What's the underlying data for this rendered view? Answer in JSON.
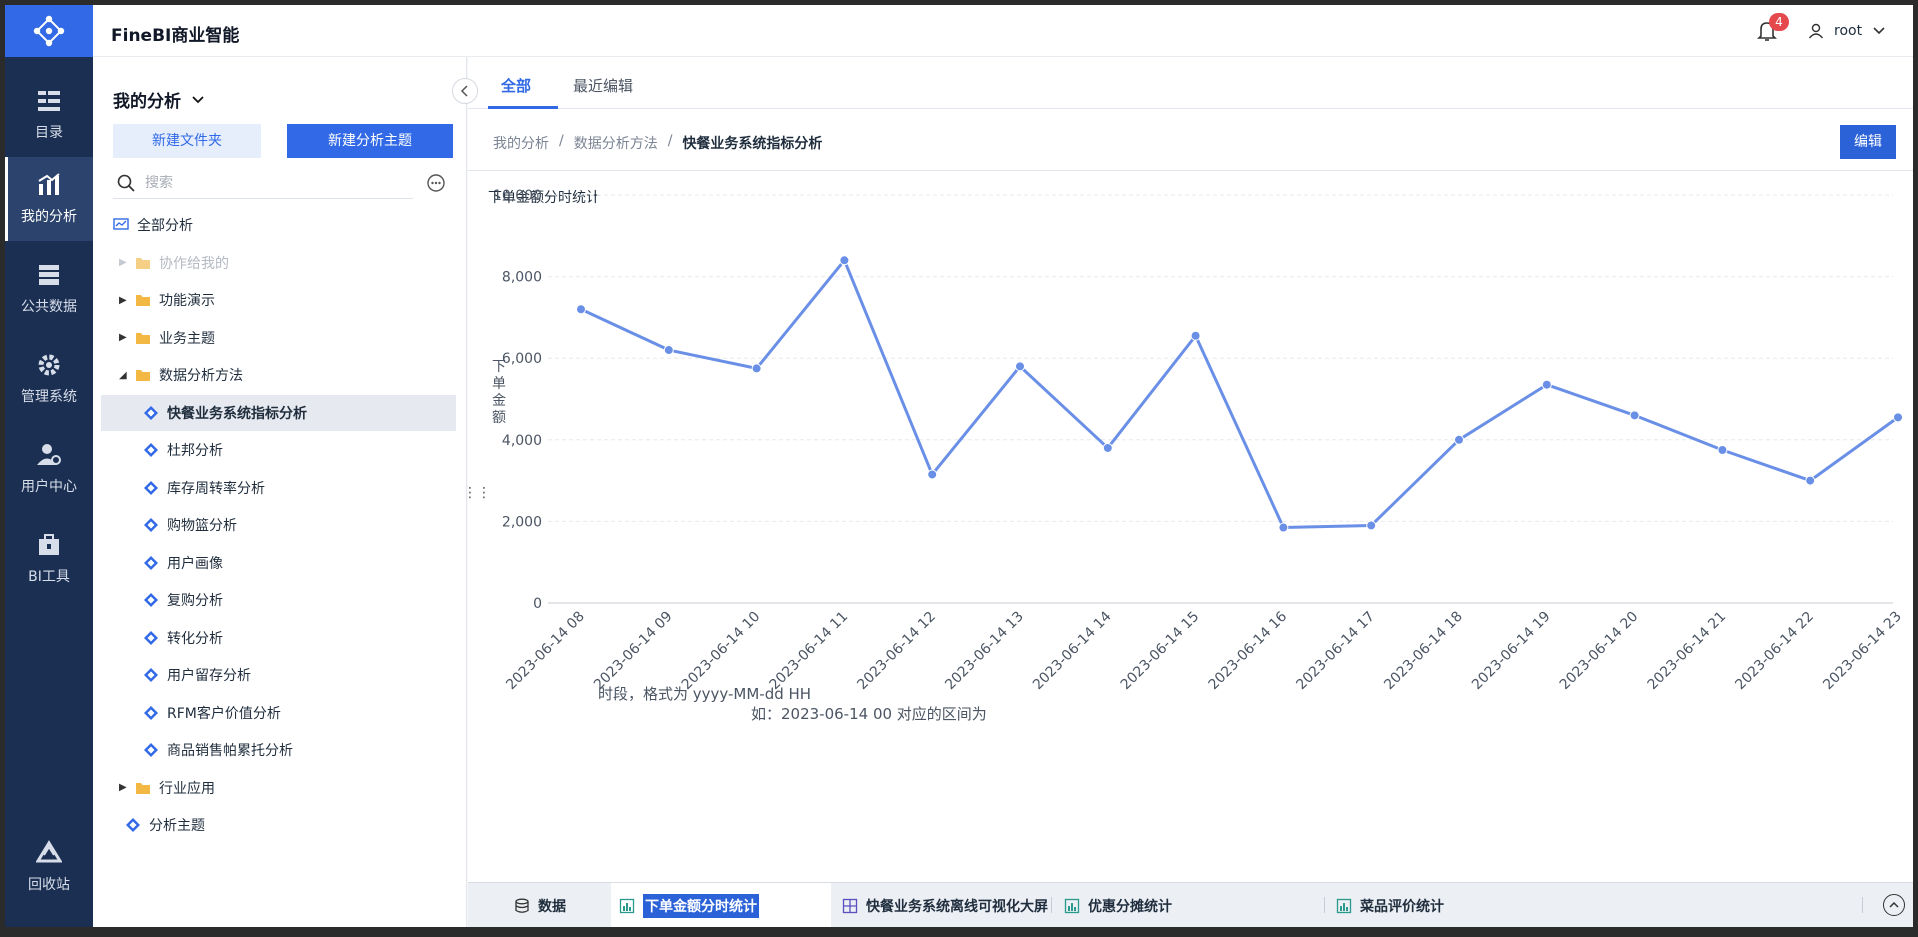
{
  "app": {
    "title": "FineBI商业智能"
  },
  "nav": [
    {
      "label": "目录",
      "icon": "catalog-icon"
    },
    {
      "label": "我的分析",
      "icon": "analysis-icon",
      "active": true
    },
    {
      "label": "公共数据",
      "icon": "database-icon"
    },
    {
      "label": "管理系统",
      "icon": "gear-icon"
    },
    {
      "label": "用户中心",
      "icon": "user-gear-icon"
    },
    {
      "label": "BI工具",
      "icon": "toolbox-icon"
    },
    {
      "label": "回收站",
      "icon": "recycle-icon"
    }
  ],
  "header": {
    "notifications": "4",
    "user": "root"
  },
  "sidebar": {
    "title": "我的分析",
    "new_folder": "新建文件夹",
    "new_topic": "新建分析主题",
    "search_placeholder": "搜索",
    "tree": [
      {
        "label": "全部分析",
        "level": 0,
        "type": "root"
      },
      {
        "label": "协作给我的",
        "level": 1,
        "type": "folder",
        "arrow": "right",
        "muted": true
      },
      {
        "label": "功能演示",
        "level": 1,
        "type": "folder",
        "arrow": "right"
      },
      {
        "label": "业务主题",
        "level": 1,
        "type": "folder",
        "arrow": "right"
      },
      {
        "label": "数据分析方法",
        "level": 1,
        "type": "folder",
        "arrow": "down"
      },
      {
        "label": "快餐业务系统指标分析",
        "level": 2,
        "type": "topic",
        "selected": true
      },
      {
        "label": "杜邦分析",
        "level": 2,
        "type": "topic"
      },
      {
        "label": "库存周转率分析",
        "level": 2,
        "type": "topic"
      },
      {
        "label": "购物篮分析",
        "level": 2,
        "type": "topic"
      },
      {
        "label": "用户画像",
        "level": 2,
        "type": "topic"
      },
      {
        "label": "复购分析",
        "level": 2,
        "type": "topic"
      },
      {
        "label": "转化分析",
        "level": 2,
        "type": "topic"
      },
      {
        "label": "用户留存分析",
        "level": 2,
        "type": "topic"
      },
      {
        "label": "RFM客户价值分析",
        "level": 2,
        "type": "topic"
      },
      {
        "label": "商品销售帕累托分析",
        "level": 2,
        "type": "topic"
      },
      {
        "label": "行业应用",
        "level": 1,
        "type": "folder",
        "arrow": "right"
      },
      {
        "label": "分析主题",
        "level": 1,
        "type": "topic"
      }
    ]
  },
  "tabs": {
    "all": "全部",
    "recent": "最近编辑"
  },
  "breadcrumb": {
    "root": "我的分析",
    "sep": "/",
    "mid": "数据分析方法",
    "current": "快餐业务系统指标分析"
  },
  "edit_label": "编辑",
  "tooltip": {
    "line1": "时段，格式为 yyyy-MM-dd HH",
    "line2": "如：2023-06-14 00 对应的区间为"
  },
  "bottom_tabs": [
    {
      "label": "数据",
      "icon": "database-icon"
    },
    {
      "label": "下单金额分时统计",
      "icon": "chart-icon",
      "active": true
    },
    {
      "label": "快餐业务系统离线可视化大屏",
      "icon": "dashboard-icon"
    },
    {
      "label": "优惠分摊统计",
      "icon": "chart-icon"
    },
    {
      "label": "菜品评价统计",
      "icon": "chart-icon"
    }
  ],
  "colors": {
    "primary": "#3169e6",
    "nav_bg": "#1b2f52",
    "line": "#6a8fe6"
  },
  "chart_data": {
    "type": "line",
    "title": "下单金额分时统计",
    "ylabel": "下单金额",
    "xlabel": "",
    "ylim": [
      0,
      10000
    ],
    "yticks": [
      "0",
      "2,000",
      "4,000",
      "6,000",
      "8,000",
      "10,000"
    ],
    "grid": true,
    "categories": [
      "2023-06-14 08",
      "2023-06-14 09",
      "2023-06-14 10",
      "2023-06-14 11",
      "2023-06-14 12",
      "2023-06-14 13",
      "2023-06-14 14",
      "2023-06-14 15",
      "2023-06-14 16",
      "2023-06-14 17",
      "2023-06-14 18",
      "2023-06-14 19",
      "2023-06-14 20",
      "2023-06-14 21",
      "2023-06-14 22",
      "2023-06-14 23"
    ],
    "series": [
      {
        "values": [
          7200,
          6200,
          5750,
          8400,
          3150,
          5800,
          3800,
          6550,
          1850,
          1900,
          4000,
          5350,
          4600,
          3750,
          3000,
          4550
        ]
      }
    ]
  }
}
